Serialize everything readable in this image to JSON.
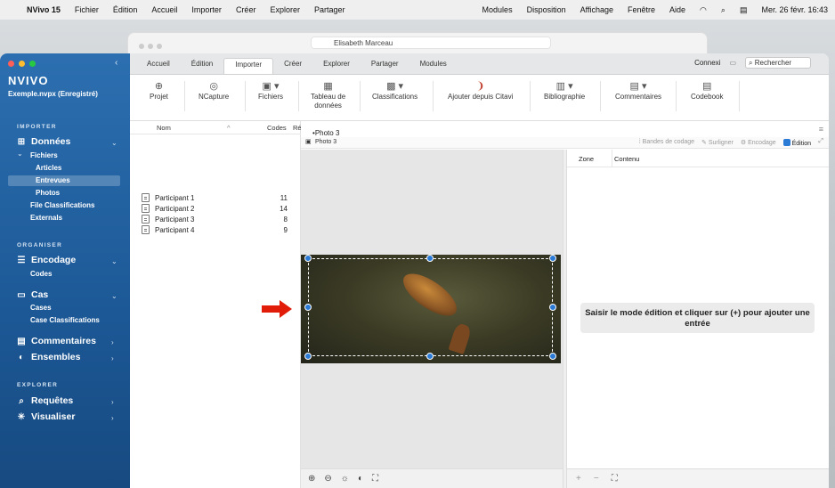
{
  "menubar": {
    "app_name": "NVivo 15",
    "items": [
      "Fichier",
      "Édition",
      "Accueil",
      "Importer",
      "Créer",
      "Explorer",
      "Partager"
    ],
    "right_items": [
      "Modules",
      "Disposition",
      "Affichage",
      "Fenêtre",
      "Aide"
    ],
    "datetime": "Mer. 26 févr. 16:43"
  },
  "background_window": {
    "tab_title": "Elisabeth Marceau"
  },
  "sidebar": {
    "logo": "NVIVO",
    "project": "Exemple.nvpx (Enregistré)",
    "sections": {
      "importer": "IMPORTER",
      "organiser": "ORGANISER",
      "explorer": "EXPLORER"
    },
    "donnees": "Données",
    "fichiers": "Fichiers",
    "articles": "Articles",
    "entrevues": "Entrevues",
    "photos": "Photos",
    "file_classifications": "File Classifications",
    "externals": "Externals",
    "encodage": "Encodage",
    "codes": "Codes",
    "cas": "Cas",
    "cases": "Cases",
    "case_classifications": "Case Classifications",
    "commentaires": "Commentaires",
    "ensembles": "Ensembles",
    "requetes": "Requêtes",
    "visualiser": "Visualiser"
  },
  "tabs": {
    "items": [
      "Accueil",
      "Édition",
      "Importer",
      "Créer",
      "Explorer",
      "Partager",
      "Modules"
    ],
    "active": "Importer",
    "connexi": "Connexi",
    "search_placeholder": "Rechercher"
  },
  "ribbon": {
    "projet": "Projet",
    "ncapture": "NCapture",
    "fichiers": "Fichiers",
    "tableau1": "Tableau de",
    "tableau2": "données",
    "classifications": "Classifications",
    "citavi": "Ajouter depuis Citavi",
    "bibliographie": "Bibliographie",
    "commentaires": "Commentaires",
    "codebook": "Codebook"
  },
  "list": {
    "col_name": "Nom",
    "col_codes": "Codes",
    "col_ref": "Ré",
    "rows": [
      {
        "name": "Participant 1",
        "codes": "11"
      },
      {
        "name": "Participant 2",
        "codes": "14"
      },
      {
        "name": "Participant 3",
        "codes": "8"
      },
      {
        "name": "Participant 4",
        "codes": "9"
      }
    ]
  },
  "viewer": {
    "tab_title": "Photo 3",
    "doc_label": "Photo 3",
    "tools": {
      "bandes": "Bandes de codage",
      "surligner": "Surligner",
      "encodage": "Encodage",
      "edition": "Édition"
    },
    "col_zone": "Zone",
    "col_contenu": "Contenu",
    "message": "Saisir le mode édition et cliquer sur (+) pour ajouter une entrée"
  }
}
